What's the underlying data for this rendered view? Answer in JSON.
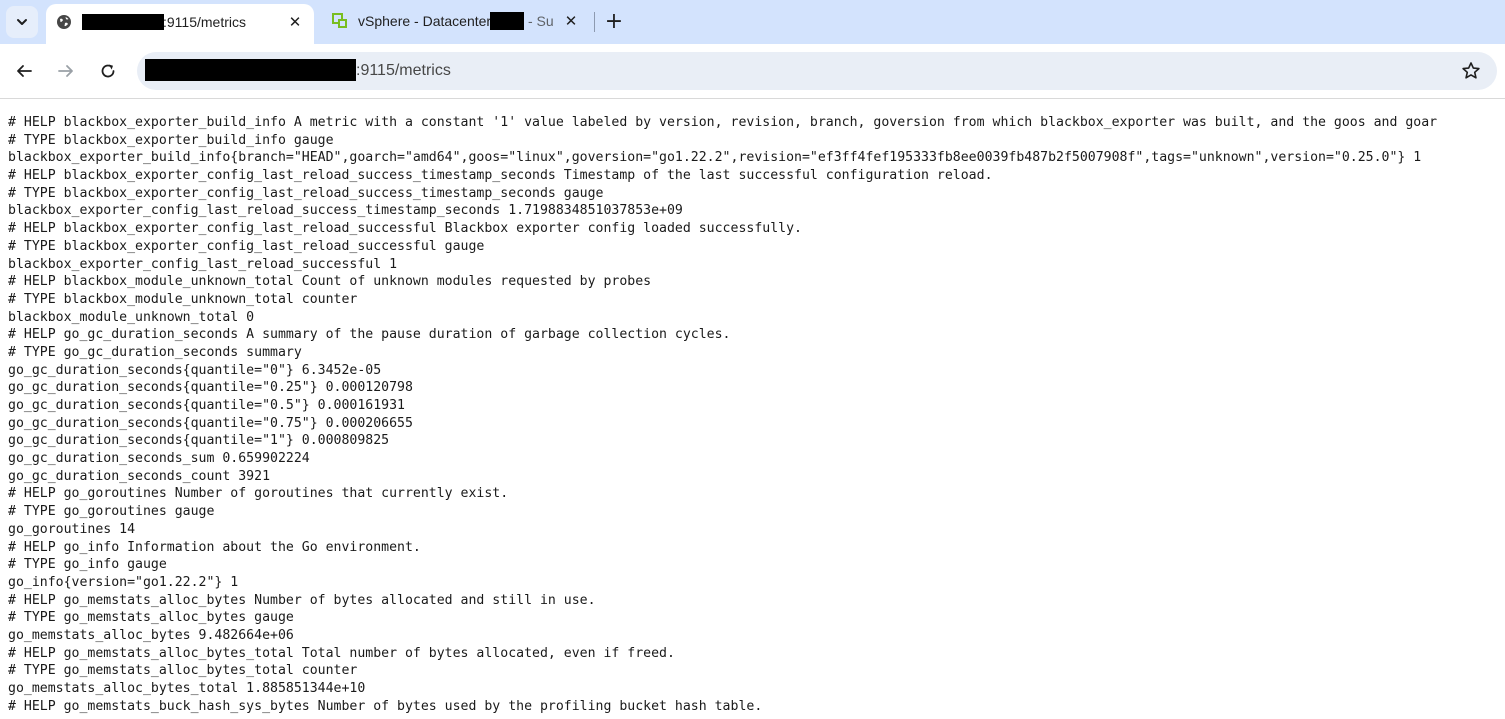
{
  "browser": {
    "tabs": [
      {
        "title": ":9115/metrics",
        "active": true,
        "icon": "globe-icon"
      },
      {
        "title": "vSphere - Datacenter",
        "title_suffix": "- Su",
        "active": false,
        "icon": "vsphere-icon"
      }
    ],
    "new_tab_label": "+",
    "close_label": "✕",
    "address_bar": {
      "url": ":9115/metrics"
    },
    "colors": {
      "tabstrip": "#d3e3fd",
      "omnibox": "#e9eef6",
      "vsphere_green": "#78be20"
    }
  },
  "metrics_lines": [
    "# HELP blackbox_exporter_build_info A metric with a constant '1' value labeled by version, revision, branch, goversion from which blackbox_exporter was built, and the goos and goar",
    "# TYPE blackbox_exporter_build_info gauge",
    "blackbox_exporter_build_info{branch=\"HEAD\",goarch=\"amd64\",goos=\"linux\",goversion=\"go1.22.2\",revision=\"ef3ff4fef195333fb8ee0039fb487b2f5007908f\",tags=\"unknown\",version=\"0.25.0\"} 1",
    "# HELP blackbox_exporter_config_last_reload_success_timestamp_seconds Timestamp of the last successful configuration reload.",
    "# TYPE blackbox_exporter_config_last_reload_success_timestamp_seconds gauge",
    "blackbox_exporter_config_last_reload_success_timestamp_seconds 1.7198834851037853e+09",
    "# HELP blackbox_exporter_config_last_reload_successful Blackbox exporter config loaded successfully.",
    "# TYPE blackbox_exporter_config_last_reload_successful gauge",
    "blackbox_exporter_config_last_reload_successful 1",
    "# HELP blackbox_module_unknown_total Count of unknown modules requested by probes",
    "# TYPE blackbox_module_unknown_total counter",
    "blackbox_module_unknown_total 0",
    "# HELP go_gc_duration_seconds A summary of the pause duration of garbage collection cycles.",
    "# TYPE go_gc_duration_seconds summary",
    "go_gc_duration_seconds{quantile=\"0\"} 6.3452e-05",
    "go_gc_duration_seconds{quantile=\"0.25\"} 0.000120798",
    "go_gc_duration_seconds{quantile=\"0.5\"} 0.000161931",
    "go_gc_duration_seconds{quantile=\"0.75\"} 0.000206655",
    "go_gc_duration_seconds{quantile=\"1\"} 0.000809825",
    "go_gc_duration_seconds_sum 0.659902224",
    "go_gc_duration_seconds_count 3921",
    "# HELP go_goroutines Number of goroutines that currently exist.",
    "# TYPE go_goroutines gauge",
    "go_goroutines 14",
    "# HELP go_info Information about the Go environment.",
    "# TYPE go_info gauge",
    "go_info{version=\"go1.22.2\"} 1",
    "# HELP go_memstats_alloc_bytes Number of bytes allocated and still in use.",
    "# TYPE go_memstats_alloc_bytes gauge",
    "go_memstats_alloc_bytes 9.482664e+06",
    "# HELP go_memstats_alloc_bytes_total Total number of bytes allocated, even if freed.",
    "# TYPE go_memstats_alloc_bytes_total counter",
    "go_memstats_alloc_bytes_total 1.885851344e+10",
    "# HELP go_memstats_buck_hash_sys_bytes Number of bytes used by the profiling bucket hash table."
  ]
}
